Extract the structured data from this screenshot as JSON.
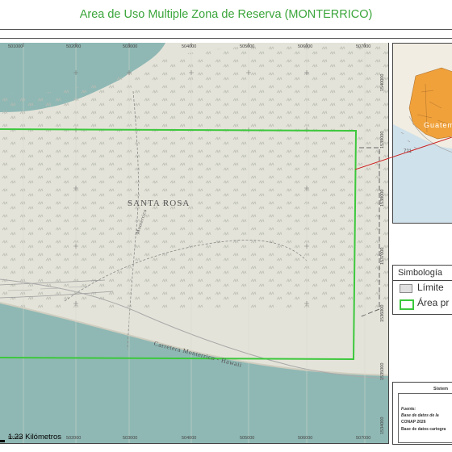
{
  "title": "Area de Uso Multiple Zona de Reserva (MONTERRICO)",
  "map": {
    "place_label": "SANTA ROSA",
    "road_label": "Carretera Monterrico - Hawaii",
    "road_label_2": "Monterrico",
    "x_ticks": [
      "501000",
      "502000",
      "503000",
      "504000",
      "505000",
      "506000",
      "507000"
    ],
    "y_ticks": [
      "1540000",
      "1539000",
      "1538000",
      "1537000",
      "1536000",
      "1535000",
      "1534000"
    ],
    "scale_label": "1.23 Kilómetros",
    "colors": {
      "sea": "#8fb8b4",
      "land": "#e4e3d9",
      "mangrove_symbol": "#b9bcb3",
      "area_border": "#3cc83c",
      "limit_line": "#666666"
    }
  },
  "inset": {
    "country_label": "Guatemala",
    "number_label": "721",
    "colors": {
      "country": "#f0a13a",
      "water": "#cfe1ea",
      "neighbor": "#f1ede2"
    }
  },
  "legend": {
    "title": "Simbología",
    "items": [
      {
        "label": "Límite",
        "color": "#e0e0e0"
      },
      {
        "label": "Área pr",
        "color": "#3cc83c"
      }
    ]
  },
  "sources": {
    "system": "Sistem",
    "label": "Fuente:",
    "line1": "Base de datos de la",
    "line2": "CONAP 2026",
    "line3": "Base de datos cartogra"
  }
}
